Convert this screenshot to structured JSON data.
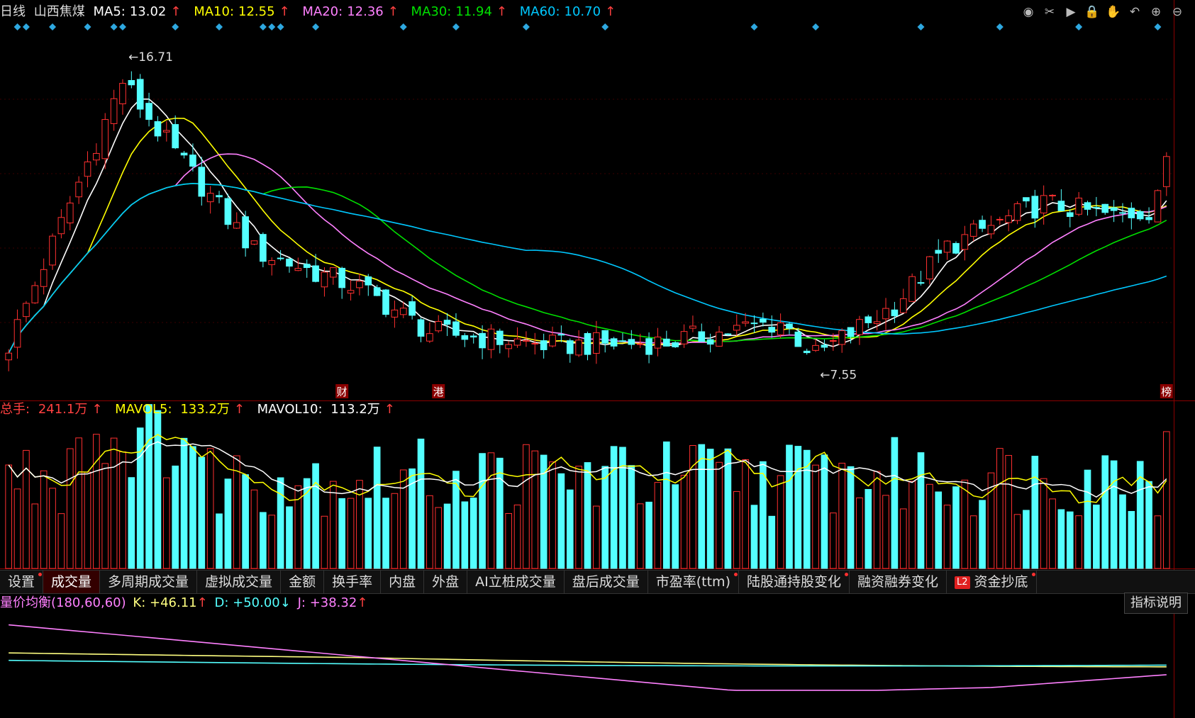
{
  "header": {
    "period": "日线",
    "stock_name": "山西焦煤",
    "ma5": {
      "label": "MA5:",
      "value": "13.02",
      "color": "#ffffff"
    },
    "ma10": {
      "label": "MA10:",
      "value": "12.55",
      "color": "#ffff00"
    },
    "ma20": {
      "label": "MA20:",
      "value": "12.36",
      "color": "#ff80ff"
    },
    "ma30": {
      "label": "MA30:",
      "value": "11.94",
      "color": "#00e000"
    },
    "ma60": {
      "label": "MA60:",
      "value": "10.70",
      "color": "#00c8ff"
    },
    "up_arrow": "↑",
    "down_arrow": "↓"
  },
  "toolbar": {
    "icons": [
      "eye-icon",
      "scissors-icon",
      "play-icon",
      "lock-icon",
      "hand-icon",
      "undo-icon",
      "zoom-in-icon",
      "zoom-out-icon"
    ],
    "glyphs": [
      "◉",
      "✂",
      "▶",
      "🔒",
      "✋",
      "↶",
      "⊕",
      "⊖"
    ]
  },
  "volume_header": {
    "total_label": "总手:",
    "total_value": "241.1万",
    "mavol5_label": "MAVOL5:",
    "mavol5_value": "133.2万",
    "mavol10_label": "MAVOL10:",
    "mavol10_value": "113.2万"
  },
  "markers": {
    "high_label": "16.71",
    "low_label": "7.55",
    "event_caicai": "财",
    "event_gang": "港",
    "event_bang": "榜"
  },
  "tabs": [
    {
      "label": "设置",
      "dot": true
    },
    {
      "label": "成交量",
      "dot": false,
      "active": true
    },
    {
      "label": "多周期成交量",
      "dot": false
    },
    {
      "label": "虚拟成交量",
      "dot": false
    },
    {
      "label": "金额",
      "dot": false
    },
    {
      "label": "换手率",
      "dot": false
    },
    {
      "label": "内盘",
      "dot": false
    },
    {
      "label": "外盘",
      "dot": false
    },
    {
      "label": "AI立桩成交量",
      "dot": false
    },
    {
      "label": "盘后成交量",
      "dot": false
    },
    {
      "label": "市盈率(ttm)",
      "dot": true
    },
    {
      "label": "陆股通持股变化",
      "dot": true
    },
    {
      "label": "融资融券变化",
      "dot": false
    },
    {
      "label": "资金抄底",
      "dot": true,
      "badge": "L2"
    }
  ],
  "kdj_header": {
    "name": "量价均衡(180,60,60)",
    "k_label": "K:",
    "k_value": "+46.11",
    "d_label": "D:",
    "d_value": "+50.00",
    "j_label": "J:",
    "j_value": "+38.32"
  },
  "explain_button": "指标说明",
  "colors": {
    "up": "#ff3030",
    "down": "#54ffff",
    "ma5": "#ffffff",
    "ma10": "#ffff00",
    "ma20": "#ff80ff",
    "ma30": "#00e000",
    "ma60": "#00c8ff",
    "k_line": "#ffff80",
    "d_line": "#54ffff",
    "j_line": "#ff80ff"
  },
  "chart_data": {
    "type": "candlestick",
    "price_range": [
      7.0,
      17.3
    ],
    "high": 16.71,
    "low": 7.55,
    "candles_count": 133,
    "key_points": [
      {
        "i": 0,
        "close": 8.2
      },
      {
        "i": 13,
        "close": 16.0
      },
      {
        "i": 18,
        "close": 14.2
      },
      {
        "i": 28,
        "close": 11.0
      },
      {
        "i": 40,
        "close": 9.9
      },
      {
        "i": 48,
        "close": 8.6
      },
      {
        "i": 62,
        "close": 8.2
      },
      {
        "i": 75,
        "close": 8.3
      },
      {
        "i": 88,
        "close": 8.9
      },
      {
        "i": 92,
        "close": 7.9
      },
      {
        "i": 101,
        "close": 9.4
      },
      {
        "i": 107,
        "close": 11.1
      },
      {
        "i": 111,
        "close": 11.6
      },
      {
        "i": 118,
        "close": 12.4
      },
      {
        "i": 126,
        "close": 12.0
      },
      {
        "i": 130,
        "close": 12.2
      },
      {
        "i": 132,
        "close": 13.5
      }
    ],
    "ma_last": {
      "MA5": 13.02,
      "MA10": 12.55,
      "MA20": 12.36,
      "MA30": 11.94,
      "MA60": 10.7
    },
    "volume_last": {
      "total": "241.1万",
      "MAVOL5": "133.2万",
      "MAVOL10": "113.2万"
    },
    "kdj_last": {
      "K": 46.11,
      "D": 50.0,
      "J": 38.32
    }
  }
}
